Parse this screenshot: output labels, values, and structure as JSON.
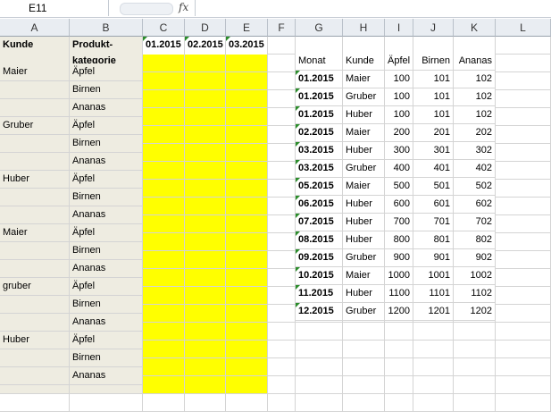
{
  "formula_bar": {
    "name_box": "E11",
    "fx_label": "fx",
    "formula": ""
  },
  "columns": [
    "A",
    "B",
    "C",
    "D",
    "E",
    "F",
    "G",
    "H",
    "I",
    "J",
    "K",
    "L"
  ],
  "left_table": {
    "headers": {
      "kunde": "Kunde",
      "produkt1": "Produkt-",
      "produkt2": "kategorie",
      "months": [
        "01.2015",
        "02.2015",
        "03.2015"
      ]
    },
    "rows": [
      {
        "kunde": "Maier",
        "produkt": "Äpfel"
      },
      {
        "kunde": "",
        "produkt": "Birnen"
      },
      {
        "kunde": "",
        "produkt": "Ananas"
      },
      {
        "kunde": "Gruber",
        "produkt": "Äpfel"
      },
      {
        "kunde": "",
        "produkt": "Birnen"
      },
      {
        "kunde": "",
        "produkt": "Ananas"
      },
      {
        "kunde": "Huber",
        "produkt": "Äpfel"
      },
      {
        "kunde": "",
        "produkt": "Birnen"
      },
      {
        "kunde": "",
        "produkt": "Ananas"
      },
      {
        "kunde": "Maier",
        "produkt": "Äpfel"
      },
      {
        "kunde": "",
        "produkt": "Birnen"
      },
      {
        "kunde": "",
        "produkt": "Ananas"
      },
      {
        "kunde": "gruber",
        "produkt": "Äpfel"
      },
      {
        "kunde": "",
        "produkt": "Birnen"
      },
      {
        "kunde": "",
        "produkt": "Ananas"
      },
      {
        "kunde": "Huber",
        "produkt": "Äpfel"
      },
      {
        "kunde": "",
        "produkt": "Birnen"
      },
      {
        "kunde": "",
        "produkt": "Ananas"
      }
    ]
  },
  "right_table": {
    "headers": [
      "Monat",
      "Kunde",
      "Äpfel",
      "Birnen",
      "Ananas"
    ],
    "rows": [
      [
        "01.2015",
        "Maier",
        "100",
        "101",
        "102"
      ],
      [
        "01.2015",
        "Gruber",
        "100",
        "101",
        "102"
      ],
      [
        "01.2015",
        "Huber",
        "100",
        "101",
        "102"
      ],
      [
        "02.2015",
        "Maier",
        "200",
        "201",
        "202"
      ],
      [
        "03.2015",
        "Huber",
        "300",
        "301",
        "302"
      ],
      [
        "03.2015",
        "Gruber",
        "400",
        "401",
        "402"
      ],
      [
        "05.2015",
        "Maier",
        "500",
        "501",
        "502"
      ],
      [
        "06.2015",
        "Huber",
        "600",
        "601",
        "602"
      ],
      [
        "07.2015",
        "Huber",
        "700",
        "701",
        "702"
      ],
      [
        "08.2015",
        "Huber",
        "800",
        "801",
        "802"
      ],
      [
        "09.2015",
        "Gruber",
        "900",
        "901",
        "902"
      ],
      [
        "10.2015",
        "Maier",
        "1000",
        "1001",
        "1002"
      ],
      [
        "11.2015",
        "Huber",
        "1100",
        "1101",
        "1102"
      ],
      [
        "12.2015",
        "Gruber",
        "1200",
        "1201",
        "1202"
      ]
    ]
  },
  "colors": {
    "header_bg": "#e9edf2",
    "tan": "#eeece1",
    "highlight": "#ffff00",
    "triangle": "#2a8c2a"
  }
}
